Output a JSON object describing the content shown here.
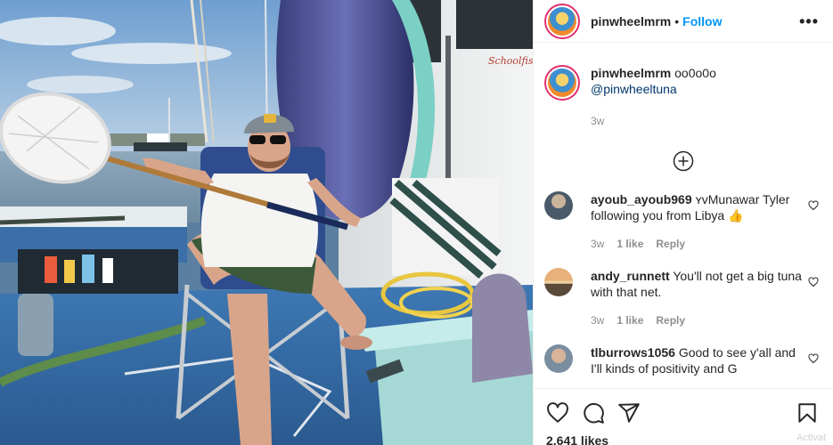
{
  "post": {
    "username": "pinwheelmrm",
    "separator": "•",
    "follow_label": "Follow",
    "more_label": "•••",
    "caption_text": "oo0o0o",
    "caption_mention": "@pinwheeltuna",
    "caption_time": "3w",
    "load_more_icon": "plus-circle-icon",
    "likes": "2,641 likes",
    "watermark": "Activat"
  },
  "comments": [
    {
      "username": "ayoub_ayoub969",
      "text": "ʏᴠMunawar Tyler following you from Libya 👍",
      "time": "3w",
      "likes": "1 like",
      "reply_label": "Reply"
    },
    {
      "username": "andy_runnett",
      "text": "You'll not get a big tuna with that net.",
      "time": "3w",
      "likes": "1 like",
      "reply_label": "Reply"
    },
    {
      "username": "tlburrows1056",
      "text": "Good to see y'all and I'll kinds of positivity and G",
      "time": "",
      "likes": "",
      "reply_label": ""
    }
  ],
  "icons": {
    "like": "heart-icon",
    "comment": "comment-icon",
    "share": "share-icon",
    "save": "bookmark-icon"
  },
  "colors": {
    "follow": "#0095f6",
    "mention": "#00376b",
    "muted": "#8e8e8e",
    "ring": "#e1306c"
  }
}
